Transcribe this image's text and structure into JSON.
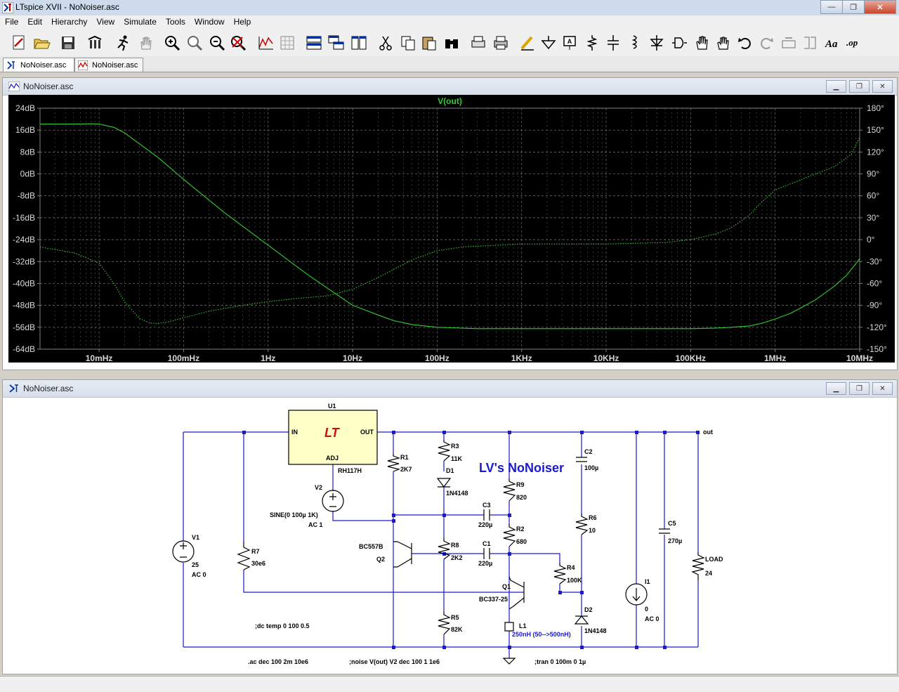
{
  "window": {
    "title": "LTspice XVII - NoNoiser.asc",
    "min": "—",
    "max": "❐",
    "close": "✕"
  },
  "menu": [
    "File",
    "Edit",
    "Hierarchy",
    "View",
    "Simulate",
    "Tools",
    "Window",
    "Help"
  ],
  "tabs": [
    {
      "label": "NoNoiser.asc"
    },
    {
      "label": "NoNoiser.asc"
    }
  ],
  "plot_pane": {
    "title": "NoNoiser.asc"
  },
  "schematic_pane": {
    "title": "NoNoiser.asc"
  },
  "colors": {
    "trace": "#33cc33",
    "grid": "#808080",
    "wire": "#1a1acc",
    "ic_fill": "#ffffc8"
  },
  "chart_data": {
    "type": "line",
    "title": "V(out)",
    "x_scale": "log",
    "xlim": [
      0.002,
      10000000
    ],
    "x_ticks": [
      "10mHz",
      "100mHz",
      "1Hz",
      "10Hz",
      "100Hz",
      "1KHz",
      "10KHz",
      "100KHz",
      "1MHz",
      "10MHz"
    ],
    "x_tick_values": [
      0.01,
      0.1,
      1,
      10,
      100,
      1000,
      10000,
      100000,
      1000000,
      10000000
    ],
    "y_left_ticks": [
      "24dB",
      "16dB",
      "8dB",
      "0dB",
      "-8dB",
      "-16dB",
      "-24dB",
      "-32dB",
      "-40dB",
      "-48dB",
      "-56dB",
      "-64dB"
    ],
    "y_left_lim": [
      -64,
      24
    ],
    "y_right_ticks": [
      "180°",
      "150°",
      "120°",
      "90°",
      "60°",
      "30°",
      "0°",
      "-30°",
      "-60°",
      "-90°",
      "-120°",
      "-150°"
    ],
    "y_right_lim": [
      -150,
      180
    ],
    "grid": true,
    "series": [
      {
        "name": "V(out)",
        "axis": "left",
        "style": "solid",
        "x": [
          0.002,
          0.004,
          0.006,
          0.008,
          0.01,
          0.015,
          0.02,
          0.03,
          0.05,
          0.1,
          0.3,
          1,
          3,
          10,
          20,
          30,
          50,
          100,
          300,
          1000,
          10000,
          100000,
          200000,
          300000,
          500000,
          700000,
          1000000,
          1500000,
          2000000,
          3000000,
          5000000,
          7000000,
          10000000
        ],
        "y": [
          18.2,
          18.2,
          18.2,
          18.3,
          18.2,
          17,
          15,
          11,
          6,
          -2,
          -14,
          -26,
          -37,
          -48,
          -51.5,
          -53.5,
          -55,
          -56,
          -56.5,
          -56.5,
          -56.5,
          -56.5,
          -56.3,
          -56,
          -55.5,
          -54.5,
          -53,
          -51,
          -49,
          -46,
          -41,
          -37,
          -31
        ]
      },
      {
        "name": "",
        "axis": "right",
        "style": "dotted",
        "x": [
          0.002,
          0.005,
          0.01,
          0.015,
          0.02,
          0.03,
          0.04,
          0.05,
          0.07,
          0.1,
          0.2,
          0.5,
          1,
          2,
          5,
          10,
          20,
          50,
          100,
          200,
          1000,
          10000,
          50000,
          100000,
          200000,
          300000,
          500000,
          700000,
          1000000,
          2000000,
          5000000,
          8000000,
          10000000
        ],
        "y": [
          -10,
          -18,
          -32,
          -60,
          -85,
          -108,
          -114,
          -115,
          -112,
          -107,
          -98,
          -90,
          -85,
          -81,
          -77,
          -68,
          -52,
          -28,
          -15,
          -10,
          -6,
          -6,
          -4,
          0,
          8,
          16,
          34,
          52,
          68,
          82,
          100,
          117,
          140
        ]
      }
    ]
  },
  "schematic": {
    "title_text": "LV's NoNoiser",
    "net_out": "out",
    "labels": {
      "u1": "U1",
      "u1_in": "IN",
      "u1_out": "OUT",
      "u1_adj": "ADJ",
      "u1_part": "RH117H",
      "v1": "V1",
      "v1_val": "25",
      "v1_ac": "AC 0",
      "v2": "V2",
      "v2_val": "SINE(0 100µ 1K)",
      "v2_ac": "AC 1",
      "r7": "R7",
      "r7_val": "30e6",
      "r1": "R1",
      "r1_val": "2K7",
      "r3": "R3",
      "r3_val": "11K",
      "d1": "D1",
      "d1_val": "1N4148",
      "c3": "C3",
      "c3_val": "220µ",
      "c1": "C1",
      "c1_val": "220µ",
      "r8": "R8",
      "r8_val": "2K2",
      "q2_part": "BC557B",
      "q2": "Q2",
      "r5": "R5",
      "r5_val": "82K",
      "r9": "R9",
      "r9_val": "820",
      "r2": "R2",
      "r2_val": "680",
      "r4": "R4",
      "r4_val": "100K",
      "q1": "Q1",
      "q1_part": "BC337-25",
      "l1": "L1",
      "l1_val": "250nH (50-->500nH)",
      "c2": "C2",
      "c2_val": "100µ",
      "r6": "R6",
      "r6_val": "10",
      "d2": "D2",
      "d2_val": "1N4148",
      "i1": "I1",
      "i1_val": "0",
      "i1_ac": "AC 0",
      "c5": "C5",
      "c5_val": "270µ",
      "load": "LOAD",
      "load_val": "24"
    },
    "directives": {
      "dc": ";dc temp 0 100 0.5",
      "ac": ".ac dec 100 2m 10e6",
      "noise": ";noise V(out) V2 dec 100 1 1e6",
      "tran": ";tran 0 100m 0 1µ"
    }
  }
}
